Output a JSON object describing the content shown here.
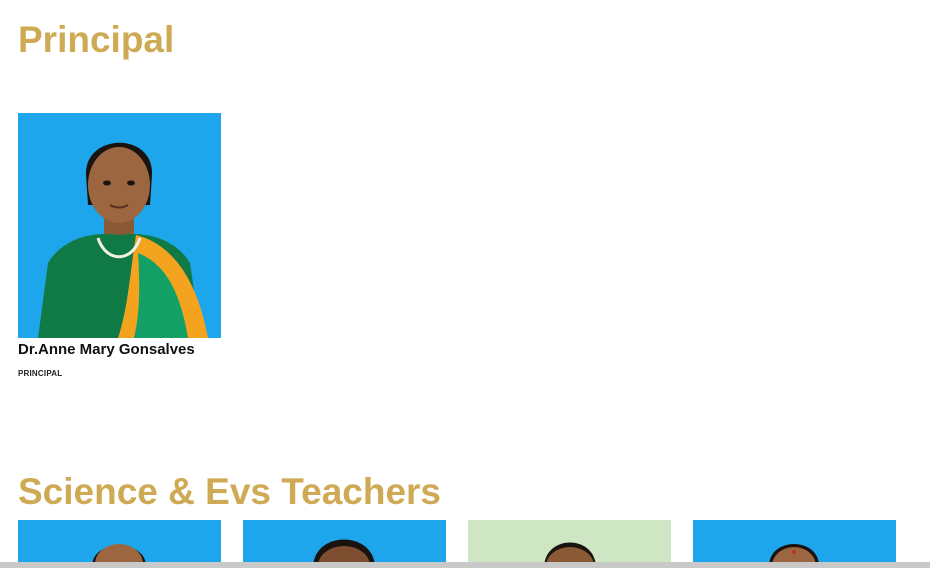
{
  "principal_section": {
    "title": "Principal",
    "staff": {
      "name": "Dr.Anne Mary Gonsalves",
      "role": "PRINCIPAL"
    }
  },
  "science_section": {
    "title": "Science & Evs Teachers"
  },
  "colors": {
    "heading": "#cfaa55",
    "photo_background": "#1ea6ec",
    "photo_background_alt": "#cfe6c4"
  }
}
